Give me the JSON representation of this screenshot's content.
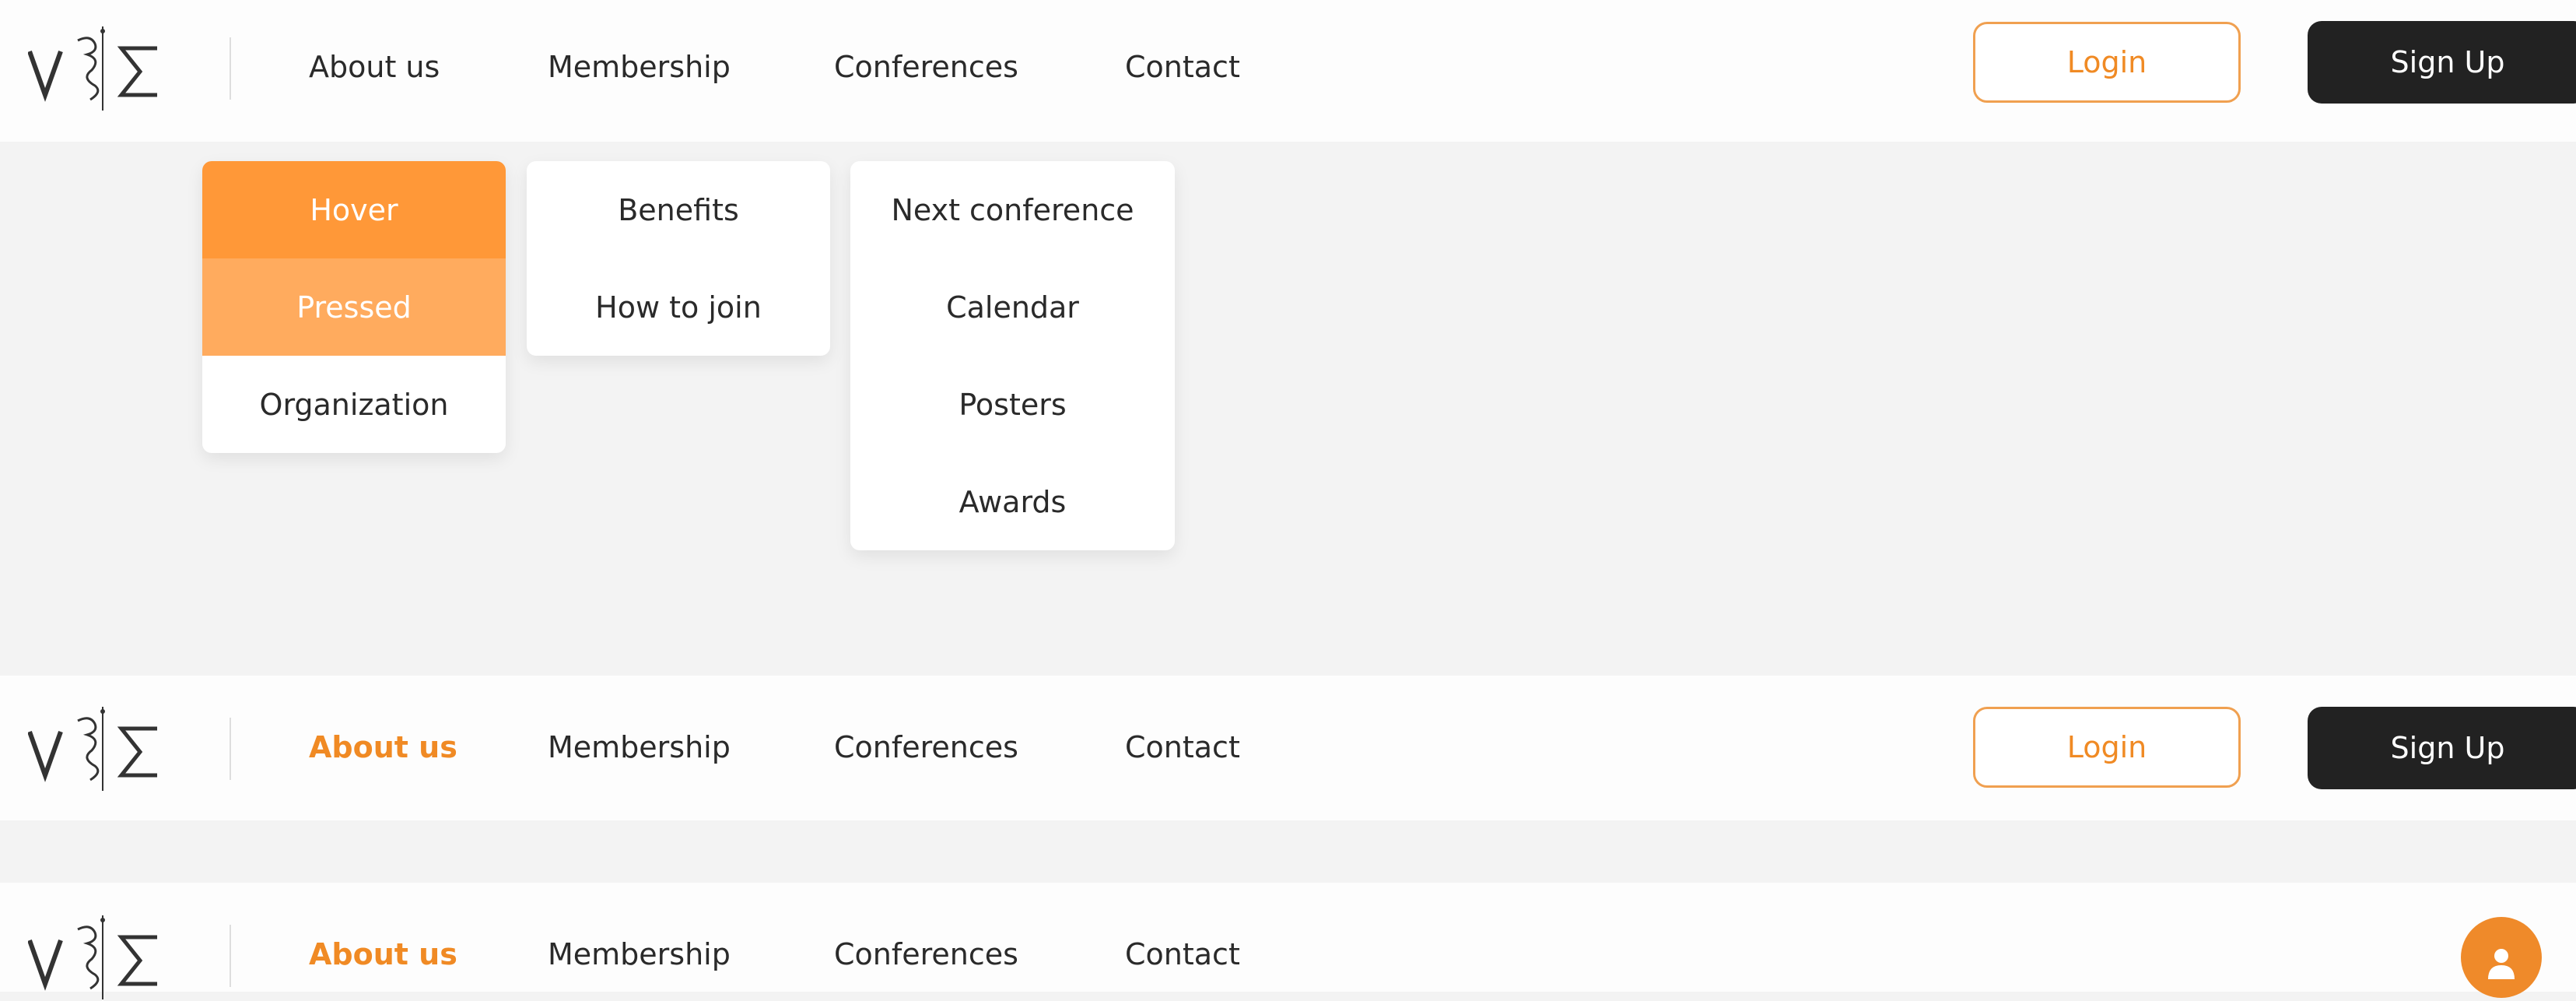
{
  "nav": {
    "links": [
      "About us",
      "Membership",
      "Conferences",
      "Contact"
    ],
    "login_label": "Login",
    "signup_label": "Sign Up"
  },
  "dropdowns": {
    "about": [
      "Hover",
      "Pressed",
      "Organization"
    ],
    "membership": [
      "Benefits",
      "How to join"
    ],
    "conferences": [
      "Next conference",
      "Calendar",
      "Posters",
      "Awards"
    ]
  },
  "colors": {
    "accent": "#f08a24",
    "hover": "#ff9838",
    "pressed": "#ffab5e",
    "dark": "#222222",
    "background": "#f3f3f3"
  },
  "icons": {
    "avatar": "user-icon"
  }
}
